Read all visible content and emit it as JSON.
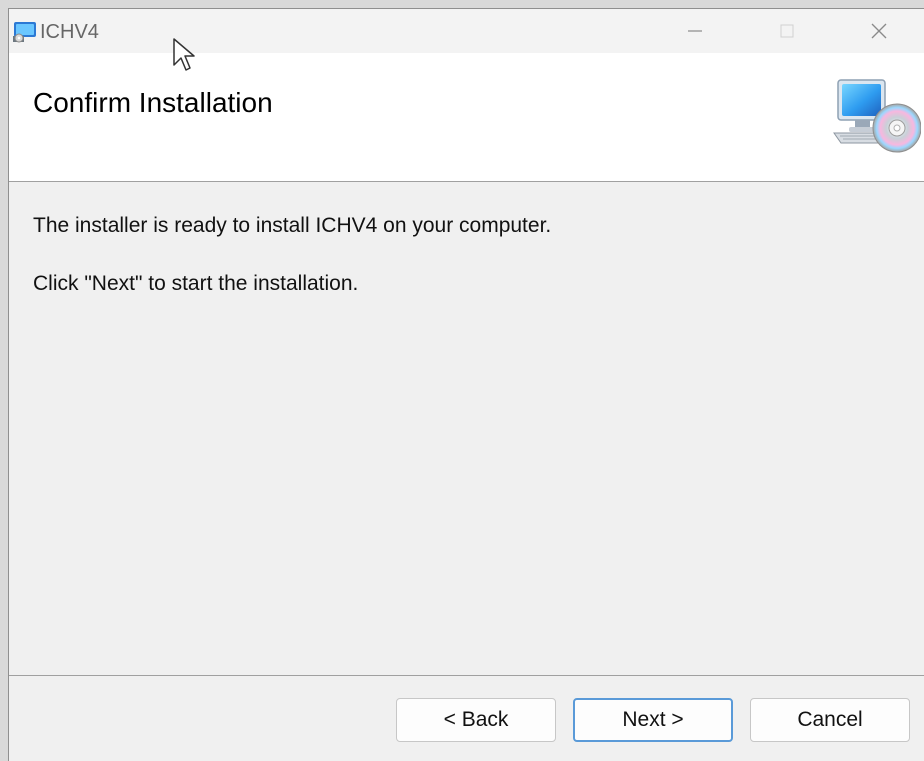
{
  "window": {
    "title": "ICHV4"
  },
  "header": {
    "title": "Confirm Installation"
  },
  "content": {
    "line1": "The installer is ready to install ICHV4 on your computer.",
    "line2": "Click \"Next\" to start the installation."
  },
  "buttons": {
    "back": "< Back",
    "next": "Next >",
    "cancel": "Cancel"
  },
  "icons": {
    "app": "installer-app-icon",
    "header": "computer-cd-icon",
    "minimize": "minimize-icon",
    "maximize": "maximize-icon",
    "close": "close-icon",
    "cursor": "mouse-pointer-icon"
  },
  "colors": {
    "window_background": "#f0f0f0",
    "header_background": "#ffffff",
    "focus_border": "#5a9ad8"
  }
}
